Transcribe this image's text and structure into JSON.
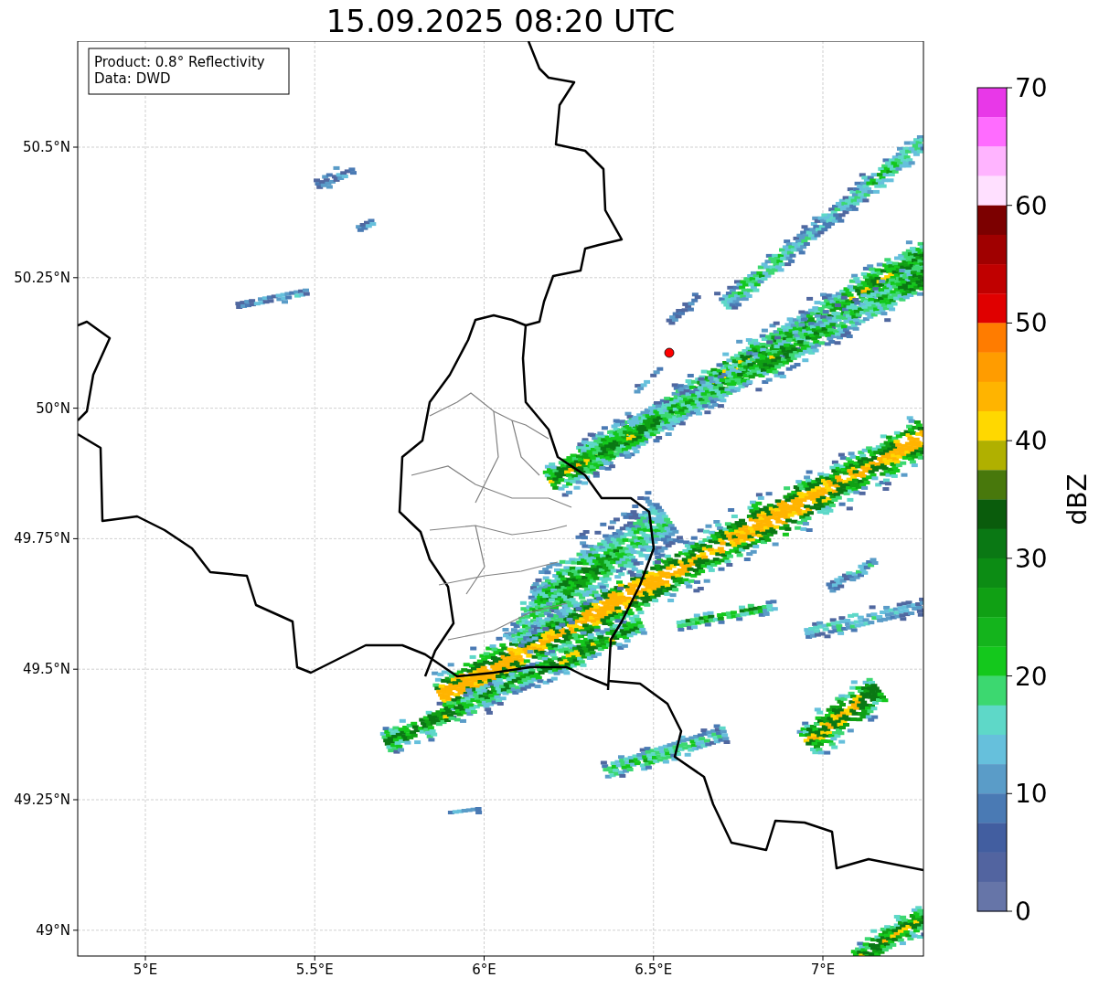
{
  "title": "15.09.2025 08:20 UTC",
  "info_box": [
    "Product: 0.8° Reflectivity",
    "Data: DWD"
  ],
  "lat_ticks": [
    "50.5°N",
    "50.25°N",
    "50°N",
    "49.75°N",
    "49.5°N",
    "49.25°N",
    "49°N"
  ],
  "lon_ticks": [
    "5°E",
    "5.5°E",
    "6°E",
    "6.5°E",
    "7°E"
  ],
  "colorbar": {
    "label": "dBZ",
    "ticks": [
      "70",
      "60",
      "50",
      "40",
      "30",
      "20",
      "10",
      "0"
    ],
    "segments": [
      {
        "color": "#e838e8"
      },
      {
        "color": "#ff6cff"
      },
      {
        "color": "#ffb4ff"
      },
      {
        "color": "#ffe0ff"
      },
      {
        "color": "#7c0000"
      },
      {
        "color": "#a00000"
      },
      {
        "color": "#c00000"
      },
      {
        "color": "#e00000"
      },
      {
        "color": "#ff7c00"
      },
      {
        "color": "#ff9c00"
      },
      {
        "color": "#ffb400"
      },
      {
        "color": "#ffd800"
      },
      {
        "color": "#b0b000"
      },
      {
        "color": "#48780c"
      },
      {
        "color": "#0a5c0c"
      },
      {
        "color": "#0a7814"
      },
      {
        "color": "#0c8c14"
      },
      {
        "color": "#10a014"
      },
      {
        "color": "#14b41c"
      },
      {
        "color": "#14c81c"
      },
      {
        "color": "#3cd870"
      },
      {
        "color": "#5ed8c8"
      },
      {
        "color": "#66c0dc"
      },
      {
        "color": "#5a9cc8"
      },
      {
        "color": "#4a7ab4"
      },
      {
        "color": "#425ea0"
      },
      {
        "color": "#5264a0"
      },
      {
        "color": "#6675a8"
      }
    ]
  }
}
